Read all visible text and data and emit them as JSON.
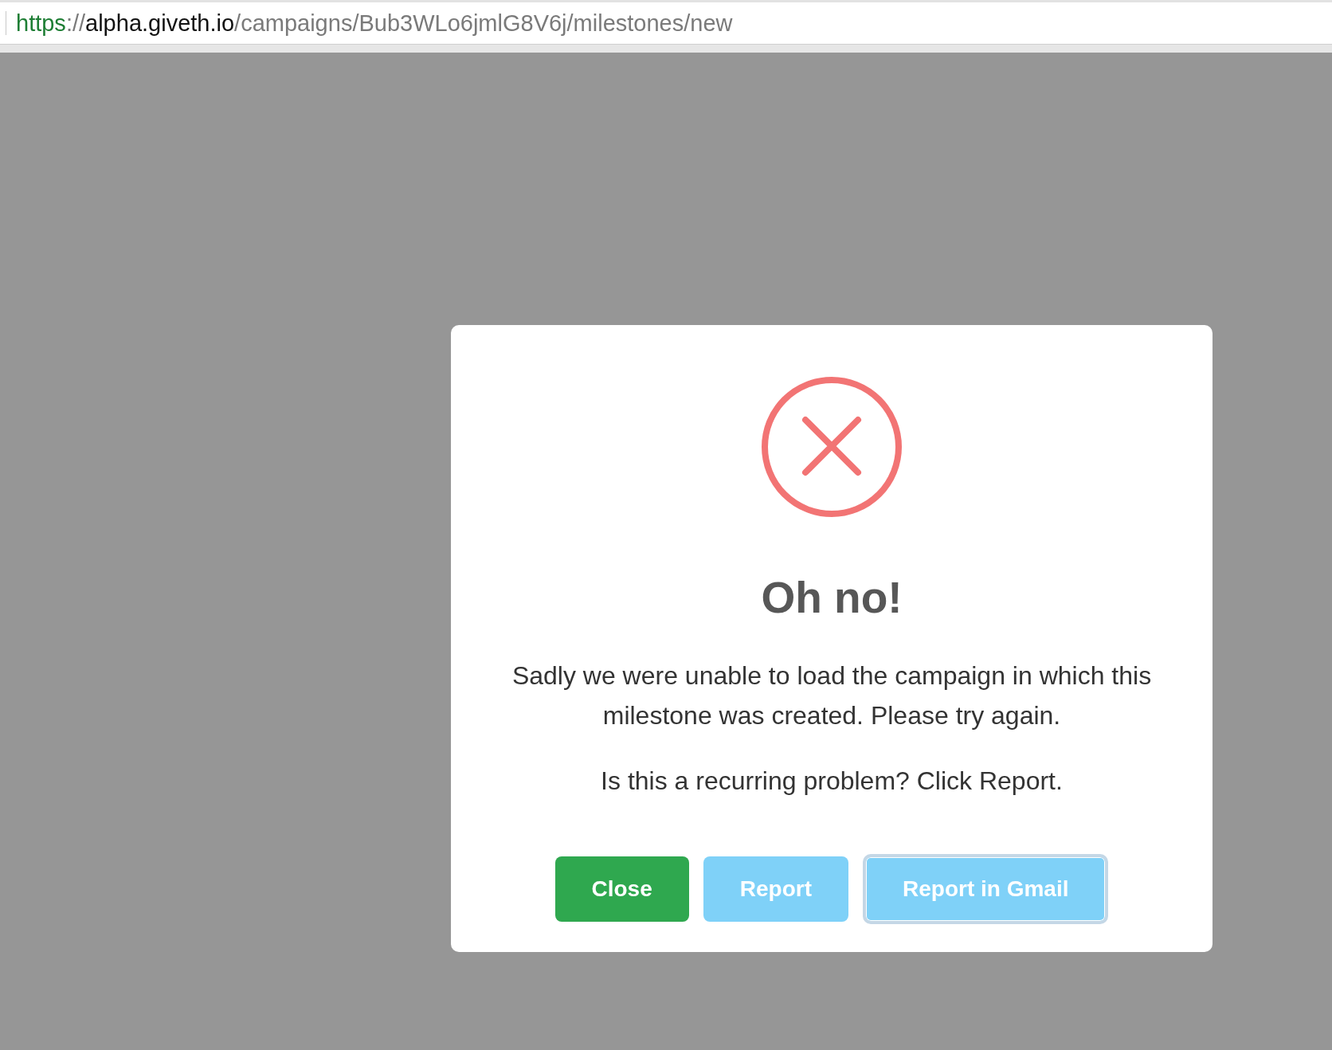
{
  "address_bar": {
    "url": {
      "scheme": "https",
      "separator": "://",
      "host": "alpha.giveth.io",
      "path": "/campaigns/Bub3WLo6jmlG8V6j/milestones/new"
    }
  },
  "dialog": {
    "title": "Oh no!",
    "messages": [
      "Sadly we were unable to load the campaign in which this milestone was created. Please try again.",
      "Is this a recurring problem? Click Report."
    ],
    "buttons": [
      {
        "label": "Close",
        "color": "#2fa84f",
        "focused": false
      },
      {
        "label": "Report",
        "color": "#7fd1f8",
        "focused": false
      },
      {
        "label": "Report in Gmail",
        "color": "#7fd1f8",
        "focused": true
      }
    ]
  }
}
